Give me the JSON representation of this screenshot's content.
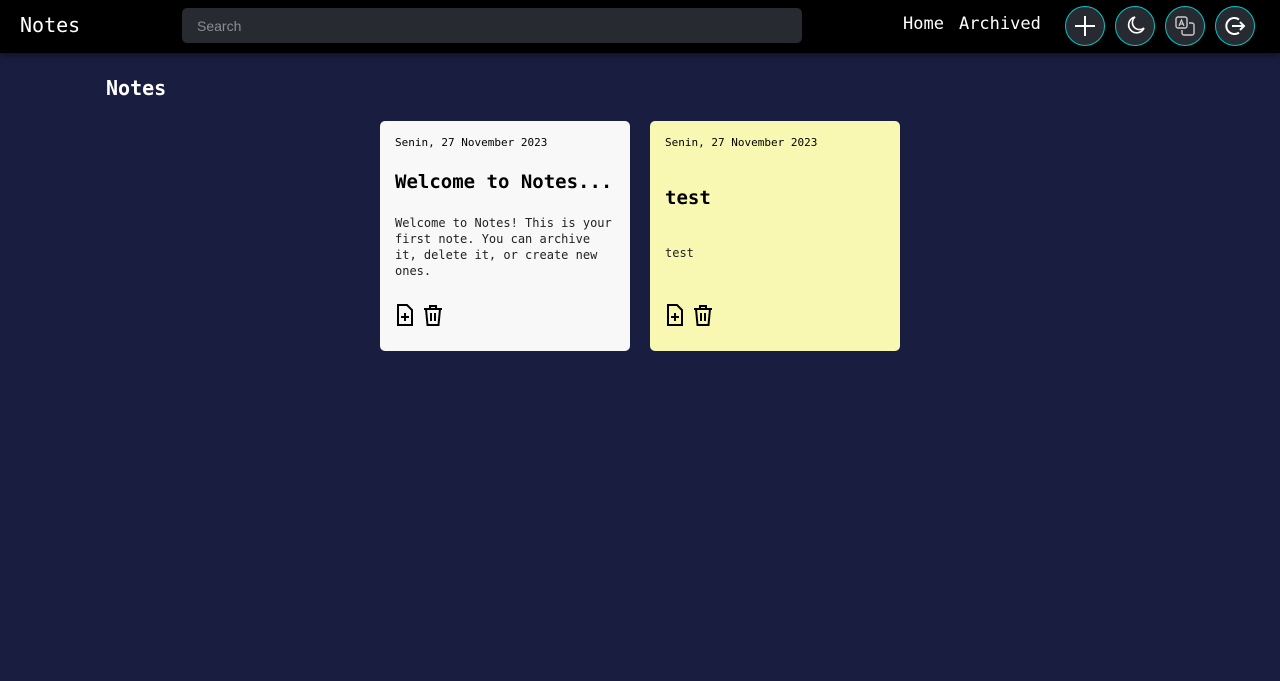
{
  "header": {
    "brand": "Notes",
    "search_placeholder": "Search",
    "nav": [
      "Home",
      "Archived"
    ],
    "buttons": [
      "add-icon",
      "moon-icon",
      "translate-icon",
      "logout-icon"
    ],
    "accent": "#00c8c8"
  },
  "page": {
    "title": "Notes"
  },
  "notes": [
    {
      "date": "Senin, 27 November 2023",
      "title": "Welcome to Notes...",
      "body": "Welcome to Notes! This is your first note. You can archive it, delete it, or create new ones.",
      "color": "#f8f8f8"
    },
    {
      "date": "Senin, 27 November 2023",
      "title": "test",
      "body": "test",
      "color": "#f8f8b2"
    }
  ]
}
